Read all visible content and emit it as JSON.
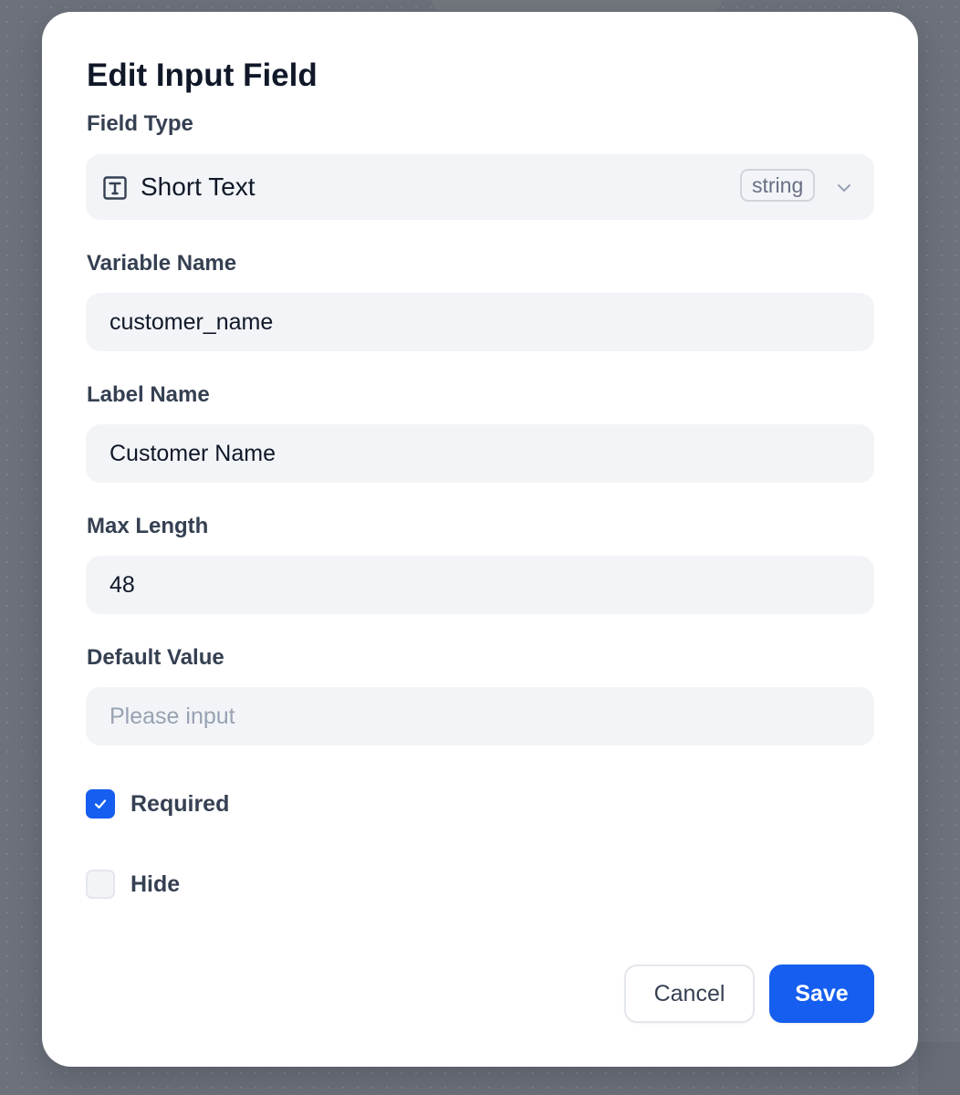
{
  "dialog": {
    "title": "Edit Input Field",
    "field_type": {
      "label": "Field Type",
      "value": "Short Text",
      "badge": "string",
      "icon": "text-type-icon"
    },
    "variable_name": {
      "label": "Variable Name",
      "value": "customer_name"
    },
    "label_name": {
      "label": "Label Name",
      "value": "Customer Name"
    },
    "max_length": {
      "label": "Max Length",
      "value": "48"
    },
    "default_value": {
      "label": "Default Value",
      "value": "",
      "placeholder": "Please input"
    },
    "required": {
      "label": "Required",
      "checked": true
    },
    "hide": {
      "label": "Hide",
      "checked": false
    },
    "buttons": {
      "cancel": "Cancel",
      "save": "Save"
    }
  },
  "colors": {
    "primary": "#155eef",
    "overlay": "#6c717c",
    "input_bg": "#f2f4f7"
  }
}
